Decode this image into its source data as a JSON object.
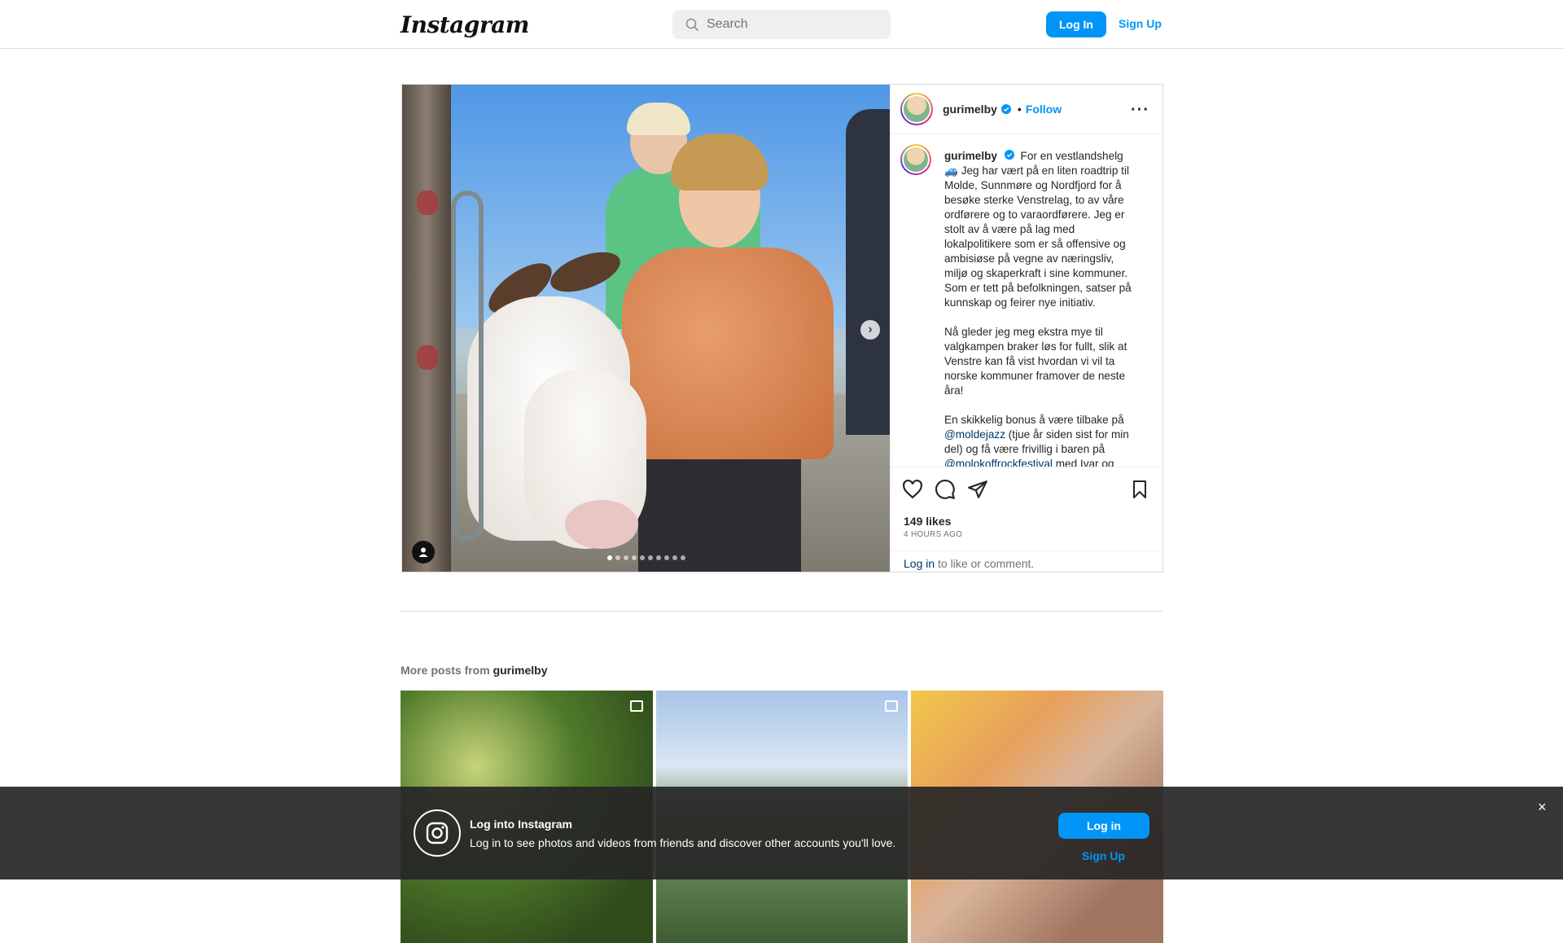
{
  "nav": {
    "logo_text": "Instagram",
    "search_placeholder": "Search",
    "login_label": "Log In",
    "signup_label": "Sign Up"
  },
  "post": {
    "username": "gurimelby",
    "follow_label": "Follow",
    "separator": "•",
    "caption_paragraphs": [
      "For en vestlandshelg 🚙 Jeg har vært på en liten roadtrip til Molde, Sunnmøre og Nordfjord for å besøke sterke Venstrelag, to av våre ordførere og to varaordførere. Jeg er stolt av å være på lag med lokalpolitikere som er så offensive og ambisiøse på vegne av næringsliv, miljø og skaperkraft i sine kommuner. Som er tett på befolkningen, satser på kunnskap og feirer nye initiativ.",
      "Nå gleder jeg meg ekstra mye til valgkampen braker løs for fullt, slik at Venstre kan få vist hvordan vi vil ta norske kommuner framover de neste åra!"
    ],
    "caption_p3_before": "En skikkelig bonus å være tilbake på ",
    "caption_mention1": "@moldejazz",
    "caption_p3_middle": " (tjue år siden sist for min del) og få være frivillig i baren på ",
    "caption_mention2": "@molokoffrockfestival",
    "caption_p3_after": " med Ivar og",
    "likes": "149 likes",
    "time": "4 HOURS AGO",
    "login_link": "Log in",
    "login_suffix": " to like or comment.",
    "carousel_count": 10,
    "carousel_active": 0
  },
  "more_posts": {
    "prefix": "More posts from ",
    "username": "gurimelby"
  },
  "banner": {
    "title": "Log into Instagram",
    "subtitle": "Log in to see photos and videos from friends and discover other accounts you'll love.",
    "login_label": "Log in",
    "signup_label": "Sign Up",
    "close_glyph": "×"
  },
  "colors": {
    "accent": "#0095f6",
    "mention": "#00376b",
    "banner_bg": "#262626"
  }
}
